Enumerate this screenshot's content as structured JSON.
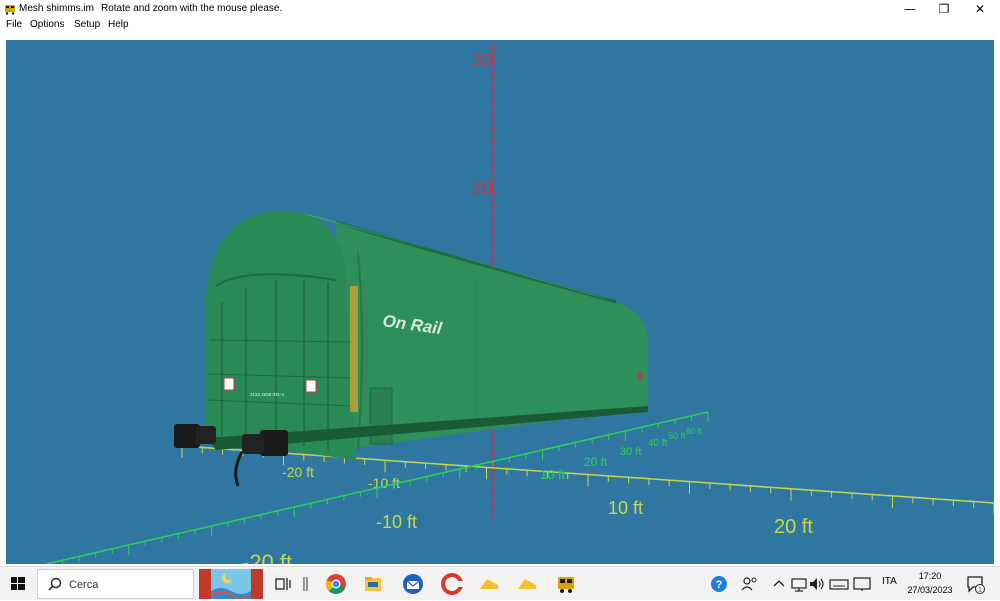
{
  "window": {
    "title": "Mesh shimms.im",
    "hint": "Rotate and zoom with the mouse please.",
    "controls": {
      "minimize": "—",
      "restore": "❐",
      "close": "✕"
    }
  },
  "menu": {
    "items": [
      "File",
      "Options",
      "Setup",
      "Help"
    ]
  },
  "viewport": {
    "background": "#2f77a0",
    "vertical_axis": {
      "color": "#c0384a",
      "labels": [
        "30",
        "20"
      ]
    },
    "floor_axis": {
      "color": "#c8d84a",
      "labels": [
        "-20 ft",
        "-10 ft",
        "10 ft",
        "20 ft",
        "-10 ft",
        "-20 ft"
      ]
    },
    "depth_axis": {
      "color": "#2ad05a",
      "labels": [
        "10 ft",
        "20 ft",
        "30 ft",
        "40 ft",
        "50 ft",
        "60 ft"
      ]
    },
    "wagon": {
      "color": "#2f8f5a",
      "brand_text": "On Rail",
      "small_marking": "2133 2638 031-2"
    }
  },
  "taskbar": {
    "search_placeholder": "Cerca",
    "language": "ITA",
    "time": "17:20",
    "date": "27/03/2023",
    "notification_count": "1",
    "pinned_icons": [
      "task-view-icon",
      "divider-icon",
      "chrome-icon",
      "file-explorer-icon",
      "thunderbird-icon",
      "ccleaner-icon",
      "cheese-app-icon",
      "cheese-app-icon",
      "train-app-icon"
    ],
    "tray_icons": [
      "help-icon",
      "people-icon",
      "chevron-up-icon",
      "network-icon",
      "volume-icon",
      "keyboard-icon",
      "display-icon"
    ]
  }
}
